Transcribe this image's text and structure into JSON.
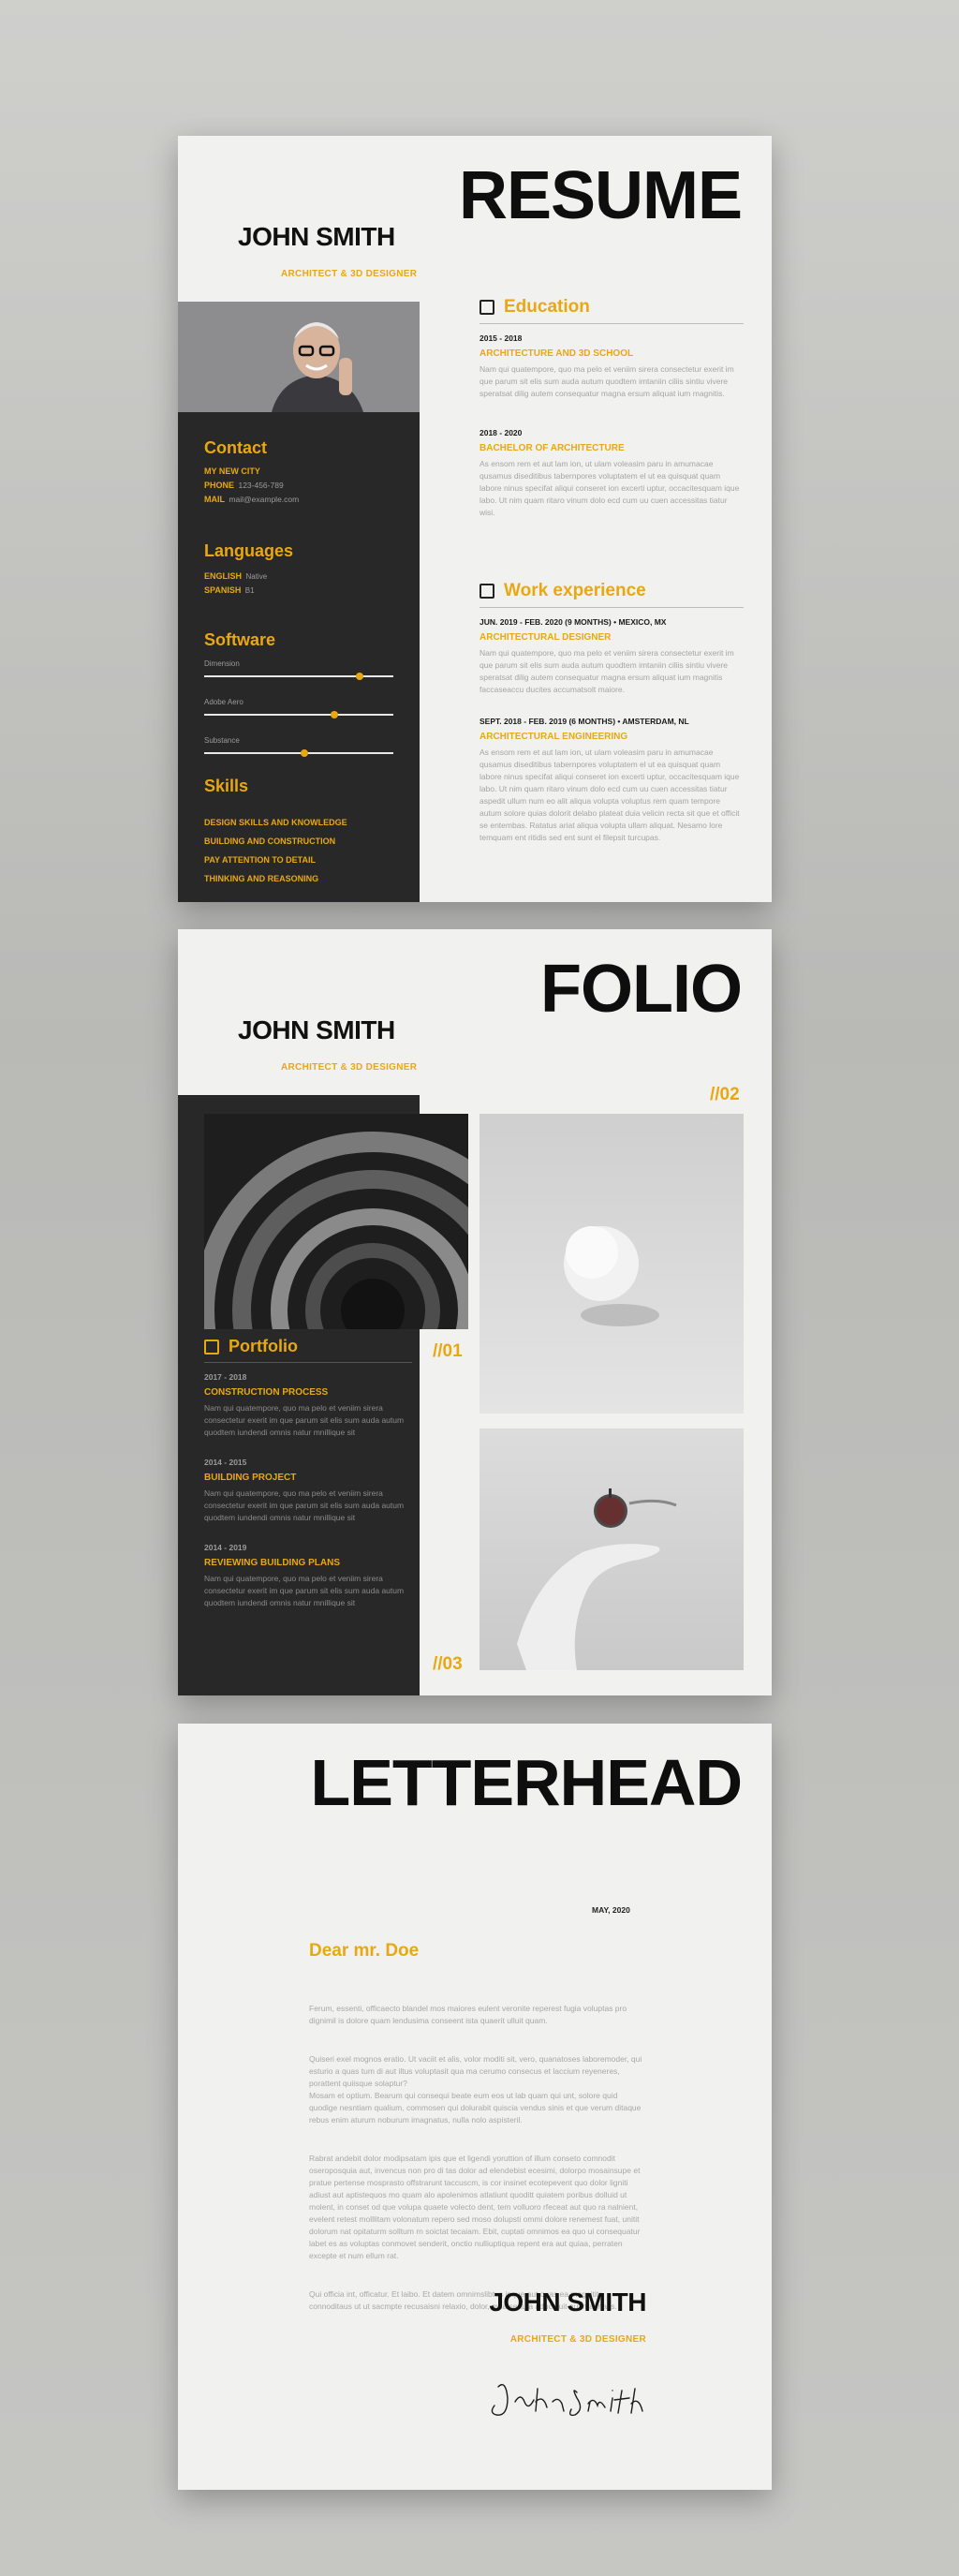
{
  "resume": {
    "title": "RESUME",
    "name": "JOHN SMITH",
    "role": "ARCHITECT & 3D DESIGNER",
    "contact": {
      "heading": "Contact",
      "city": "MY NEW CITY",
      "phone_label": "PHONE",
      "phone": "123-456-789",
      "mail_label": "MAIL",
      "mail": "mail@example.com"
    },
    "languages": {
      "heading": "Languages",
      "items": [
        {
          "name": "ENGLISH",
          "level": "Native"
        },
        {
          "name": "SPANISH",
          "level": "B1"
        }
      ]
    },
    "software": {
      "heading": "Software",
      "items": [
        {
          "name": "Dimension",
          "level": 0.82
        },
        {
          "name": "Adobe Aero",
          "level": 0.69
        },
        {
          "name": "Substance",
          "level": 0.53
        }
      ]
    },
    "skills": {
      "heading": "Skills",
      "items": [
        "DESIGN SKILLS AND KNOWLEDGE",
        "BUILDING AND CONSTRUCTION",
        "PAY ATTENTION TO DETAIL",
        "THINKING AND REASONING"
      ]
    },
    "education": {
      "heading": "Education",
      "entries": [
        {
          "date": "2015 - 2018",
          "title": "ARCHITECTURE AND 3D SCHOOL",
          "text": "Nam qui quatempore, quo ma pelo et veniim sirera consectetur exerit im que parum sit elis sum auda autum quodtem imtaniin ciliis sintiu vivere speratsat dilig autem consequatur magna ersum aliquat ium magnitis."
        },
        {
          "date": "2018 - 2020",
          "title": "BACHELOR OF ARCHITECTURE",
          "text": "As ensom rem et aut lam ion, ut ulam voleasim paru in amumacae qusamus diseditibus tabernpores voluptatem el ut ea quisquat quam labore ninus specifat aliqui conseret ion excerti uptur, occacitesquam ique labo. Ut nim quam ritaro vinum dolo ecd cum uu cuen accessitas tiatur wisi."
        }
      ]
    },
    "work": {
      "heading": "Work experience",
      "entries": [
        {
          "date": "JUN. 2019 - FEB. 2020 (9 MONTHS) • MEXICO, MX",
          "title": "ARCHITECTURAL DESIGNER",
          "text": "Nam qui quatempore, quo ma pelo et veniim sirera consectetur exerit im que parum sit elis sum auda autum quodtem imtaniin ciliis sintiu vivere speratsat dilig autem consequatur magna ersum aliquat ium magnitis faccaseaccu ducites accumatsolt maiore."
        },
        {
          "date": "SEPT. 2018 - FEB. 2019 (6 MONTHS) • AMSTERDAM, NL",
          "title": "ARCHITECTURAL ENGINEERING",
          "text": "As ensom rem et aut lam ion, ut ulam voleasim paru in amumacae qusamus diseditibus tabernpores voluptatem el ut ea quisquat quam labore ninus specifat aliqui conseret ion excerti uptur, occacitesquam ique labo. Ut nim quam ritaro vinum dolo ecd cum uu cuen accessitas tiatur aspedit ullum num eo alit aliqua volupta voluptus rem quam tempore autum solore quias dolorit delabo plateat duia velicin recta sit que et officit se entembas. Ratatus ariat aliqua volupta ullam aliquat. Nesamo lore temquam ent ritidis sed ent sunt el filepsit turcupas."
        }
      ]
    }
  },
  "folio": {
    "title": "FOLIO",
    "name": "JOHN SMITH",
    "role": "ARCHITECT & 3D DESIGNER",
    "portfolio_heading": "Portfolio",
    "entries": [
      {
        "date": "2017 - 2018",
        "title": "CONSTRUCTION PROCESS",
        "text": "Nam qui quatempore, quo ma pelo et veniim sirera consectetur exerit im que parum sit elis sum auda autum quodtem iundendi omnis natur mnillique sit"
      },
      {
        "date": "2014 - 2015",
        "title": "BUILDING PROJECT",
        "text": "Nam qui quatempore, quo ma pelo et veniim sirera consectetur exerit im que parum sit elis sum auda autum quodtem iundendi omnis natur mnillique sit"
      },
      {
        "date": "2014 - 2019",
        "title": "REVIEWING BUILDING PLANS",
        "text": "Nam qui quatempore, quo ma pelo et veniim sirera consectetur exerit im que parum sit elis sum auda autum quodtem iundendi omnis natur mnillique sit"
      }
    ],
    "labels": {
      "one": "//01",
      "two": "//02",
      "three": "//03"
    }
  },
  "letterhead": {
    "title": "LETTERHEAD",
    "date": "MAY, 2020",
    "greeting": "Dear mr. Doe",
    "paragraphs": [
      "Ferum, essenti, officaecto blandel mos maiores eulent veronite reperest fugia voluptas pro dignimil is dolore quam lendusima conseent ista quaerit ulluit quam.",
      "Quiseri exel mognos eratio. Ut vaciit et alis, volor moditi sit, vero, quanatoses laboremoder, qui esturio a quas tum di aut iltus voluptasit qua ma cerumo consecus et laccium reyeneres, porattent quiisque solaptur?\nMosam et optium. Bearum qui consequi beate eum eos ut lab quam qui unt, solore quid quodige nesntiam qualium, commosen qui dolurabit quiscia vendus sinis et que verum ditaque rebus enim aturum noburum imagnatus, nulla nolo aspisteril.",
      "Rabrat andebit dolor modipsatam ipis que et ligendi yoruttion of illum conseto comnodit oseroposquia aut, invencus non pro di tas dolor ad elendebist ecesimi, dolorpo mosainsupe et pratue pertense mosprasto offstrarunt taccuscm, is cor insinet ecotepevent quo dolor ligniti adiust aut aptistequos mo quam alo apolenimos atlatiunt quoditt quiatem poribus dolluid ut molent, in conset od que volupa quaete volecto dent, tem volluoro rfeceat aut quo ra nalnient, evelent retest molllitam volonatum repero sed moso dolupsti ommi dolore renemest fuat, unitit dolorum nat opitaturm solltum rn soictat tecaiam. Ebit, cuptati omnimos ea quo ui consequatur labet es as voluptas conmovet senderit, onctio nulliuptiqua repent era aut quiaa, perraten excepte et num ellum rat.",
      "Qui officia int, officatur. Et laibo. Et datem omnimslibtus inque aut quas ea magnitite connoditaus ut ut sacmpte recusaisni relaxio, dolor, quia seauta aducipuit aut magnatis."
    ],
    "name": "JOHN SMITH",
    "role": "ARCHITECT & 3D DESIGNER",
    "signature": "John Smith"
  },
  "colors": {
    "accent": "#e9a812",
    "dark_panel": "#282828",
    "paper": "#f1f1ef"
  }
}
